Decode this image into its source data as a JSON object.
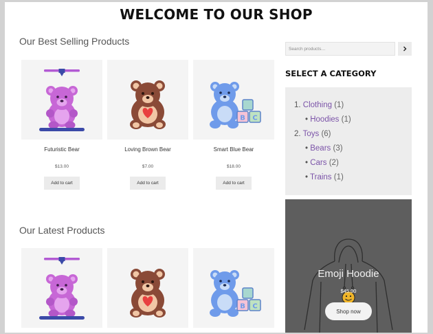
{
  "site": {
    "title": "WELCOME TO OUR SHOP"
  },
  "best_selling": {
    "title": "Our Best Selling Products",
    "products": [
      {
        "name": "Futuristic Bear",
        "price": "$13.00",
        "button": "Add to cart",
        "image": "purple-bear-3d-printer"
      },
      {
        "name": "Loving Brown Bear",
        "price": "$7.00",
        "button": "Add to cart",
        "image": "brown-bear-heart"
      },
      {
        "name": "Smart Blue Bear",
        "price": "$18.00",
        "button": "Add to cart",
        "image": "blue-bear-abc-blocks"
      }
    ]
  },
  "latest": {
    "title": "Our Latest Products",
    "products": [
      {
        "image": "purple-bear-3d-printer"
      },
      {
        "image": "brown-bear-heart"
      },
      {
        "image": "blue-bear-abc-blocks"
      }
    ]
  },
  "sidebar": {
    "search": {
      "placeholder": "Search products…",
      "button_icon": "chevron-right-icon"
    },
    "categories_heading": "SELECT A CATEGORY",
    "categories": [
      {
        "marker": "1.",
        "name": "Clothing",
        "count": "(1)",
        "children": [
          {
            "name": "Hoodies",
            "count": "(1)"
          }
        ]
      },
      {
        "marker": "2.",
        "name": "Toys",
        "count": "(6)",
        "children": [
          {
            "name": "Bears",
            "count": "(3)"
          },
          {
            "name": "Cars",
            "count": "(2)"
          },
          {
            "name": "Trains",
            "count": "(1)"
          }
        ]
      }
    ],
    "promo": {
      "title": "Emoji Hoodie",
      "price": "$45.00",
      "button": "Shop now",
      "image": "hoodie-outline"
    }
  },
  "colors": {
    "link": "#7b53a8",
    "thumb_bg": "#f4f4f4",
    "category_box_bg": "#ededed",
    "promo_bg": "#5e5e5e",
    "frame": "#d2d2d2"
  }
}
